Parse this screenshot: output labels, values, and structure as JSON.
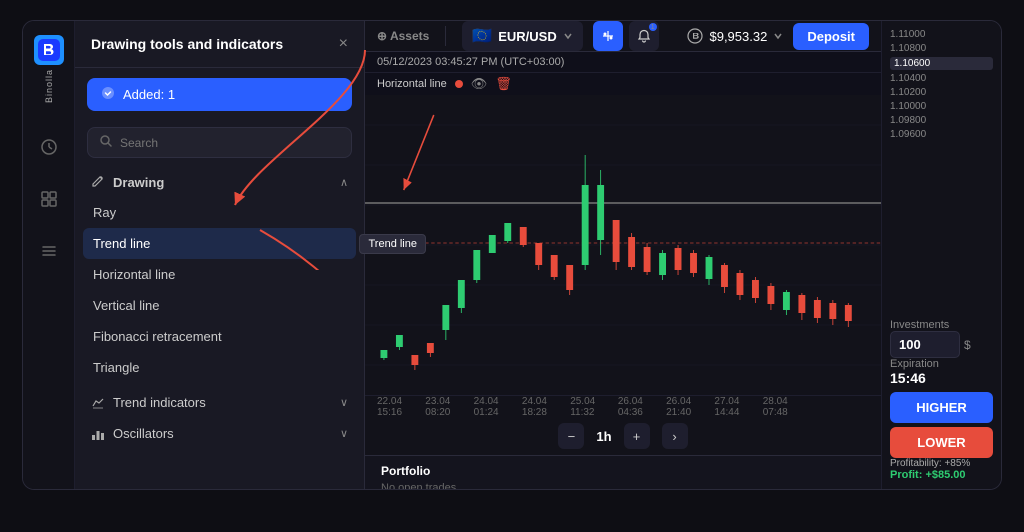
{
  "app": {
    "name": "Binolla",
    "logo_char": "B"
  },
  "drawing_panel": {
    "title": "Drawing tools and indicators",
    "close_label": "×",
    "added_label": "Added: 1",
    "search_placeholder": "Search",
    "drawing_section": "Drawing",
    "drawing_items": [
      {
        "id": "ray",
        "label": "Ray",
        "active": false,
        "highlighted": false
      },
      {
        "id": "trend-line",
        "label": "Trend line",
        "active": true,
        "highlighted": true
      },
      {
        "id": "horizontal-line",
        "label": "Horizontal line",
        "active": false,
        "highlighted": false,
        "tooltip": "Trend line"
      },
      {
        "id": "vertical-line",
        "label": "Vertical line",
        "active": false,
        "highlighted": false
      },
      {
        "id": "fibonacci",
        "label": "Fibonacci retracement",
        "active": false,
        "highlighted": false
      },
      {
        "id": "triangle",
        "label": "Triangle",
        "active": false,
        "highlighted": false
      }
    ],
    "trend_indicators_label": "Trend indicators",
    "oscillators_label": "Oscillators"
  },
  "chart_header": {
    "currency": "EUR/USD",
    "flag": "🇪🇺",
    "balance": "$9,953.32",
    "deposit_label": "Deposit",
    "indicator_bar": {
      "datetime": "05/12/2023 03:45:27 PM (UTC+03:00)",
      "line_label": "Horizontal line"
    }
  },
  "chart": {
    "price_levels": [
      "1.11000",
      "1.10800",
      "1.10600",
      "1.10400",
      "1.10200",
      "1.10000",
      "1.09800",
      "1.09600"
    ],
    "time_labels": [
      "22.04 15:16",
      "23.04 08:20",
      "24.04 01:24",
      "24.04 18:28",
      "25.04 11:32",
      "26.04 04:36",
      "26.04 21:40",
      "27.04 14:44",
      "28.04 07:48"
    ],
    "timeframe": "1h",
    "minus_label": "−",
    "plus_label": "+",
    "forward_label": "›"
  },
  "right_panel": {
    "investments_label": "Investments",
    "investments_value": "100",
    "investments_unit": "$",
    "expiration_label": "Expiration",
    "expiration_value": "15:46",
    "higher_label": "HIGHER",
    "lower_label": "LOWER",
    "profitability_label": "Profitability: +85%",
    "profit_label": "Profit: +$85.00"
  },
  "portfolio": {
    "title": "Portfolio",
    "empty_label": "No open trades"
  },
  "left_nav": {
    "items": [
      "◉",
      "⊞",
      "◈",
      "◇",
      "▣"
    ]
  }
}
